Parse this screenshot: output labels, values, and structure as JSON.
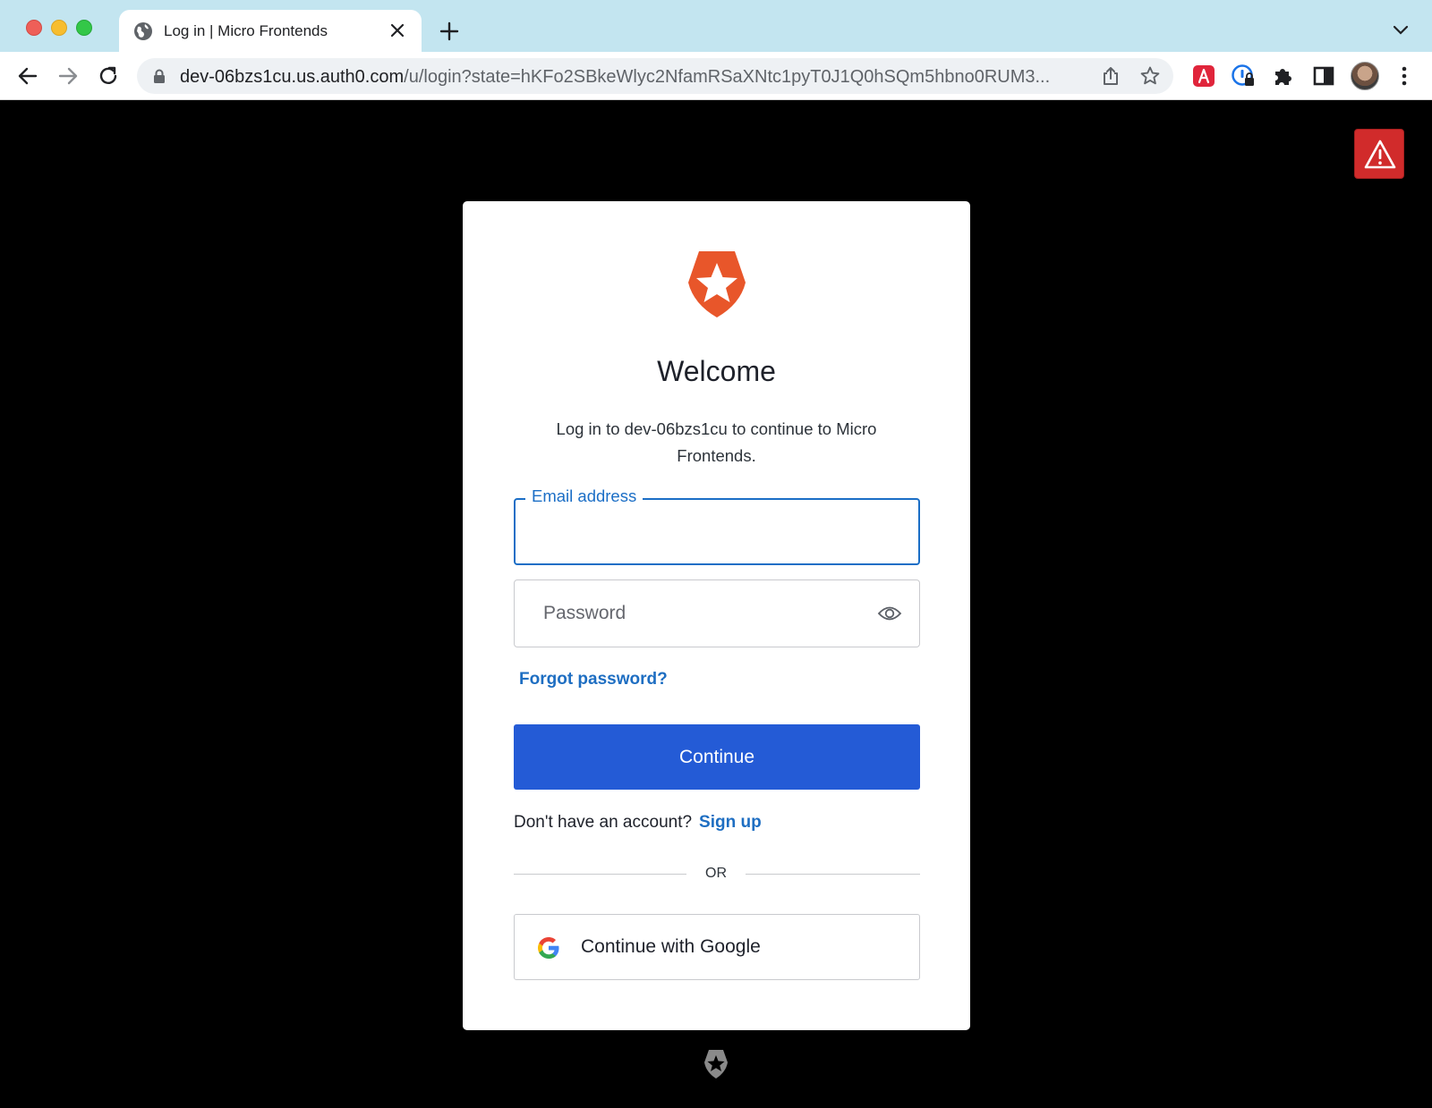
{
  "browser": {
    "tab_title": "Log in | Micro Frontends",
    "url_host": "dev-06bzs1cu.us.auth0.com",
    "url_path": "/u/login?state=hKFo2SBkeWlyc2NfamRSaXNtc1pyT0J1Q0hSQm5hbno0RUM3..."
  },
  "login": {
    "title": "Welcome",
    "subtitle": "Log in to dev-06bzs1cu to continue to Micro Frontends.",
    "email_label": "Email address",
    "email_value": "",
    "password_placeholder": "Password",
    "forgot_password": "Forgot password?",
    "continue_label": "Continue",
    "no_account_text": "Don't have an account?",
    "signup_label": "Sign up",
    "divider_text": "OR",
    "google_label": "Continue with Google"
  },
  "colors": {
    "primary_button": "#245bd6",
    "link": "#1e6ec2",
    "focus_border": "#1b6ec6",
    "brand_logo": "#e8562a",
    "warning_badge": "#d12b2b"
  },
  "icons": [
    "globe-icon",
    "close-icon",
    "plus-icon",
    "chevron-down-icon",
    "back-arrow-icon",
    "forward-arrow-icon",
    "reload-icon",
    "lock-icon",
    "share-icon",
    "star-icon",
    "extension-icon",
    "password-manager-icon",
    "puzzle-icon",
    "sidebar-icon",
    "kebab-menu-icon",
    "warning-icon",
    "eye-icon",
    "google-icon",
    "auth0-shield-icon"
  ]
}
